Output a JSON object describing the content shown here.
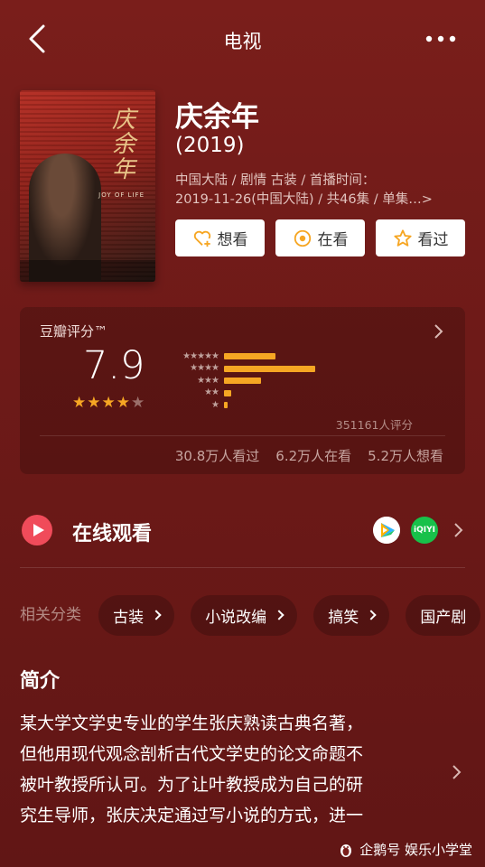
{
  "header": {
    "title": "电视",
    "back_icon": "chevron-left-icon",
    "more_icon": "more-dots-icon"
  },
  "show": {
    "name": "庆余年",
    "year": "(2019)",
    "meta_line1": "中国大陆 / 剧情 古装 / 首播时间：",
    "meta_line2": "2019-11-26(中国大陆) / 共46集 / 单集…>",
    "poster_title": "庆余年",
    "poster_en": "JOY OF LIFE"
  },
  "actions": [
    {
      "label": "想看",
      "icon": "heart-plus-icon"
    },
    {
      "label": "在看",
      "icon": "circle-dot-icon"
    },
    {
      "label": "看过",
      "icon": "star-outline-icon"
    }
  ],
  "rating": {
    "title": "豆瓣评分™",
    "score": "7.9",
    "stars_filled": 4,
    "stars_total": 5,
    "distribution": [
      {
        "stars": "★★★★★",
        "fraction": 0.29
      },
      {
        "stars": "★★★★",
        "fraction": 0.52
      },
      {
        "stars": "★★★",
        "fraction": 0.21
      },
      {
        "stars": "★★",
        "fraction": 0.04
      },
      {
        "stars": "★",
        "fraction": 0.02
      }
    ],
    "votes": "351161人评分",
    "counts": [
      "30.8万人看过",
      "6.2万人在看",
      "5.2万人想看"
    ],
    "bar_color": "#f6a623",
    "star_color": "#f6a623"
  },
  "watch": {
    "label": "在线观看",
    "providers": [
      "tencent-video-icon",
      "iqiyi-icon"
    ],
    "iqiyi_text": "iQIYI"
  },
  "categories": {
    "label": "相关分类",
    "items": [
      "古装",
      "小说改编",
      "搞笑",
      "国产剧"
    ]
  },
  "intro": {
    "heading": "简介",
    "lines": [
      "某大学文学史专业的学生张庆熟读古典名著，",
      "但他用现代观念剖析古代文学史的论文命题不",
      "被叶教授所认可。为了让叶教授成为自己的研",
      "究生导师，张庆决定通过写小说的方式，进一"
    ]
  },
  "watermark": {
    "text": "企鹅号 娱乐小学堂",
    "icon": "penguin-icon"
  }
}
